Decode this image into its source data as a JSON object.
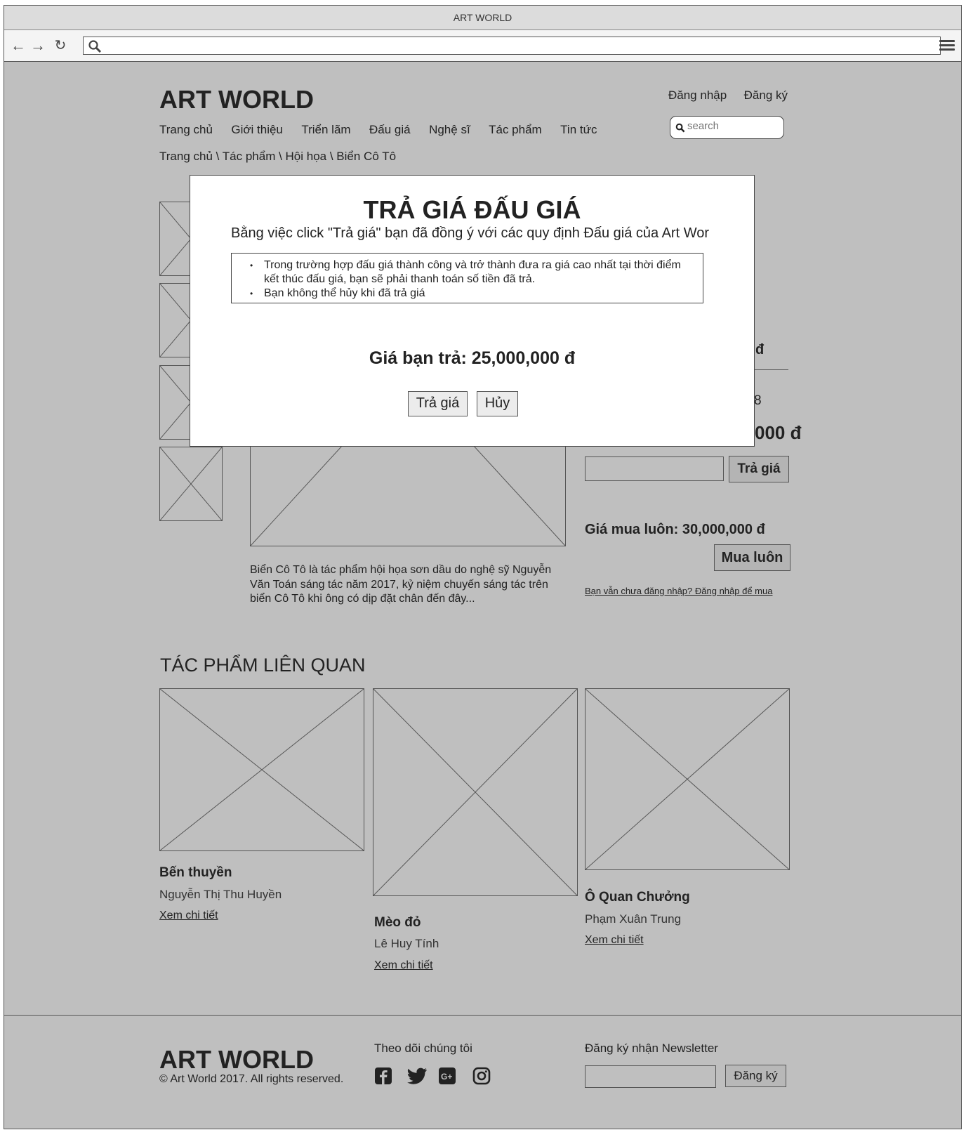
{
  "window": {
    "title": "ART WORLD"
  },
  "header": {
    "logo": "ART WORLD",
    "login": "Đăng nhập",
    "register": "Đăng ký",
    "search_placeholder": "search",
    "nav": [
      "Trang chủ",
      "Giới thiệu",
      "Triển lãm",
      "Đấu giá",
      "Nghệ sĩ",
      "Tác phẩm",
      "Tin tức"
    ],
    "breadcrumb": "Trang chủ \\ Tác phẩm \\ Hội họa \\ Biển Cô Tô"
  },
  "artwork": {
    "description": "Biển Cô Tô là tác phẩm hội họa sơn dầu do nghệ sỹ Nguyễn Văn Toán sáng tác năm 2017, kỷ niệm chuyến sáng tác trên biển Cô Tô khi ông có dịp đặt chân đến đây..."
  },
  "auction": {
    "partial_price_suffix": "đ",
    "partial_time": "8",
    "partial_current": "000 đ",
    "bid_button": "Trả giá",
    "buy_now_price": "Giá mua luôn: 30,000,000 đ",
    "buy_now_button": "Mua luôn",
    "login_hint": "Bạn vẫn chưa đăng nhập?  Đăng nhập để mua"
  },
  "related": {
    "title": "TÁC PHẨM LIÊN QUAN",
    "items": [
      {
        "title": "Bến thuyền",
        "artist": "Nguyễn Thị Thu Huyền",
        "link": "Xem chi tiết"
      },
      {
        "title": "Mèo đỏ",
        "artist": "Lê Huy Tính",
        "link": "Xem chi tiết"
      },
      {
        "title": "Ô Quan Chưởng",
        "artist": "Phạm Xuân Trung",
        "link": "Xem chi tiết"
      }
    ]
  },
  "footer": {
    "logo": "ART WORLD",
    "copyright": "© Art World 2017. All rights reserved.",
    "follow": "Theo dõi chúng tôi",
    "social_icons": [
      "facebook-icon",
      "twitter-icon",
      "google-plus-icon",
      "instagram-icon"
    ],
    "newsletter": "Đăng ký nhận Newsletter",
    "subscribe_button": "Đăng ký"
  },
  "modal": {
    "title": "TRẢ GIÁ ĐẤU GIÁ",
    "subtitle": "Bằng việc click \"Trả giá\" bạn đã đồng ý với các quy định Đấu giá của Art World",
    "rules": [
      "Trong trường hợp đấu giá thành công và trở thành đưa ra giá cao nhất tại thời điểm kết thúc đấu giá, bạn sẽ phải thanh toán số tiền đã trả.",
      "Bạn không thể hủy khi đã trả giá"
    ],
    "price": "Giá bạn trả: 25,000,000 đ",
    "confirm": "Trả giá",
    "cancel": "Hủy"
  }
}
